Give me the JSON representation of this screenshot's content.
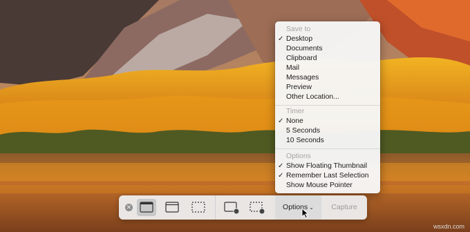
{
  "menu": {
    "save_to": {
      "header": "Save to",
      "items": [
        {
          "label": "Desktop",
          "checked": true
        },
        {
          "label": "Documents",
          "checked": false
        },
        {
          "label": "Clipboard",
          "checked": false
        },
        {
          "label": "Mail",
          "checked": false
        },
        {
          "label": "Messages",
          "checked": false
        },
        {
          "label": "Preview",
          "checked": false
        },
        {
          "label": "Other Location...",
          "checked": false
        }
      ]
    },
    "timer": {
      "header": "Timer",
      "items": [
        {
          "label": "None",
          "checked": true
        },
        {
          "label": "5 Seconds",
          "checked": false
        },
        {
          "label": "10 Seconds",
          "checked": false
        }
      ]
    },
    "options": {
      "header": "Options",
      "items": [
        {
          "label": "Show Floating Thumbnail",
          "checked": true
        },
        {
          "label": "Remember Last Selection",
          "checked": true
        },
        {
          "label": "Show Mouse Pointer",
          "checked": false
        }
      ]
    },
    "check_glyph": "✓"
  },
  "toolbar": {
    "close_glyph": "✕",
    "options_label": "Options",
    "options_chevron": "⌄",
    "capture_label": "Capture",
    "modes": [
      {
        "name": "capture-entire-screen-icon",
        "active": true
      },
      {
        "name": "capture-window-icon",
        "active": false
      },
      {
        "name": "capture-selection-icon",
        "active": false
      },
      {
        "name": "record-entire-screen-icon",
        "active": false
      },
      {
        "name": "record-selection-icon",
        "active": false
      }
    ]
  },
  "watermark": "wsxdn.com",
  "colors": {
    "menu_bg": "#f6f6f6",
    "menu_header": "#a3a3a3",
    "toolbar_bg": "#ececec",
    "capture_disabled": "#9a9a9a",
    "sky": "#c98f5a",
    "foliage": "#e8a010",
    "lake": "#b8662a"
  }
}
